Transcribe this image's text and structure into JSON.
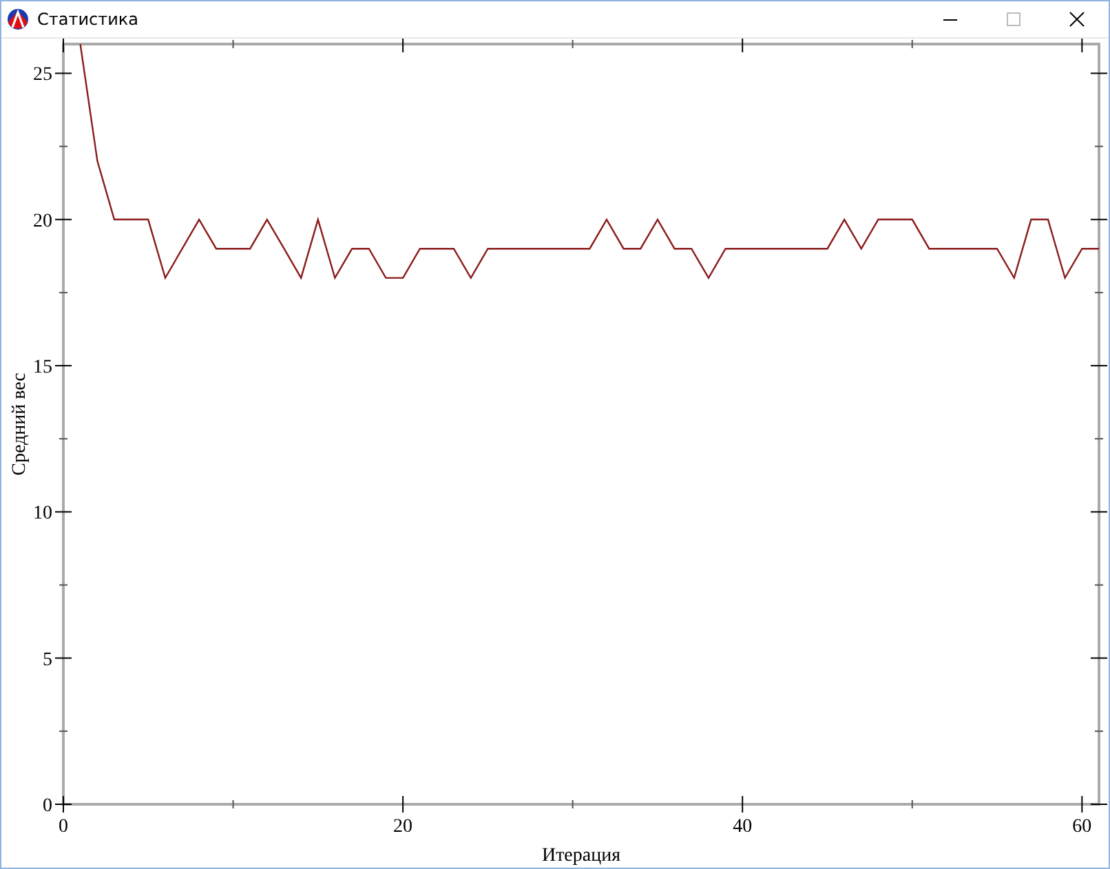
{
  "window": {
    "title": "Статистика"
  },
  "plot": {
    "chart_data": {
      "type": "line",
      "xlabel": "Итерация",
      "ylabel": "Средний вес",
      "xlim": [
        0,
        61
      ],
      "ylim": [
        0,
        26
      ],
      "xticks": [
        0,
        20,
        40,
        60
      ],
      "yticks": [
        0,
        5,
        10,
        15,
        20,
        25
      ],
      "x": [
        1,
        2,
        3,
        4,
        5,
        6,
        7,
        8,
        9,
        10,
        11,
        12,
        13,
        14,
        15,
        16,
        17,
        18,
        19,
        20,
        21,
        22,
        23,
        24,
        25,
        26,
        27,
        28,
        29,
        30,
        31,
        32,
        33,
        34,
        35,
        36,
        37,
        38,
        39,
        40,
        41,
        42,
        43,
        44,
        45,
        46,
        47,
        48,
        49,
        50,
        51,
        52,
        53,
        54,
        55,
        56,
        57,
        58,
        59,
        60,
        61
      ],
      "series": [
        {
          "color": "#8b1a1a",
          "values": [
            26,
            22,
            20,
            20,
            20,
            18,
            19,
            20,
            19,
            19,
            19,
            20,
            19,
            18,
            20,
            18,
            19,
            19,
            18,
            18,
            19,
            19,
            19,
            18,
            19,
            19,
            19,
            19,
            19,
            19,
            19,
            20,
            19,
            19,
            20,
            19,
            19,
            18,
            19,
            19,
            19,
            19,
            19,
            19,
            19,
            20,
            19,
            20,
            20,
            20,
            19,
            19,
            19,
            19,
            19,
            18,
            20,
            20,
            18,
            19,
            19
          ]
        }
      ]
    }
  }
}
